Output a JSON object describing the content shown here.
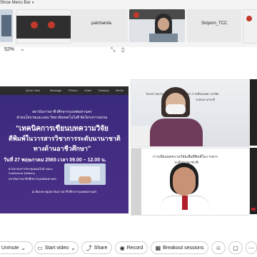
{
  "menu": {
    "label": "Show Menu Bar"
  },
  "participants": [
    {
      "name": "patcharida"
    },
    {
      "name": "Siriporn_TCC"
    }
  ],
  "zoom": {
    "value": "52%"
  },
  "share_toolbar": [
    "Quick View",
    "Message",
    "Photos",
    "Video",
    "Desktop",
    "Media"
  ],
  "slide": {
    "line1": "สถาบันการอาชีวศึกษากรุงเทพมหานคร",
    "line2": "ฝ่ายนโยบายและแผน วิทยาลัยเทคโนโลยี จัดโครงการอบรม",
    "title1": "\"เทคนิคการเขียนบทความวิจัย",
    "title2": "ตีพิมพ์ในวารสารวิชาการระดับนานาชาติ",
    "title3": "ทางด้านอาชีวศึกษา\"",
    "date": "วันที่ 27 พฤษภาคม 2565 เวลา 09.00 – 12.00 น.",
    "note1": "ผ่านระบบการประชุมออนไลน์ Video Conference (Webex)",
    "note2": "สถาบันการอาชีวศึกษากรุงเทพมหานคร",
    "footer": "ณ ห้องประชุมสถาบันการอาชีวศึกษากรุงเทพมหานคร"
  },
  "right_slide": {
    "line1": "โครงการอบรมเชิงปฏิบัติการหลักสูตร การเขียนบทความวิจัย",
    "line2": "ระดับนานาชาติ",
    "line3": "การเขียนบทความวิจัยเพื่อตีพิมพ์ในวารสาร",
    "line4": "ระดับนานาชาติ"
  },
  "controls": {
    "unmute": "Unmute",
    "start_video": "Start video",
    "share": "Share",
    "record": "Record",
    "breakout": "Breakout sessions"
  }
}
